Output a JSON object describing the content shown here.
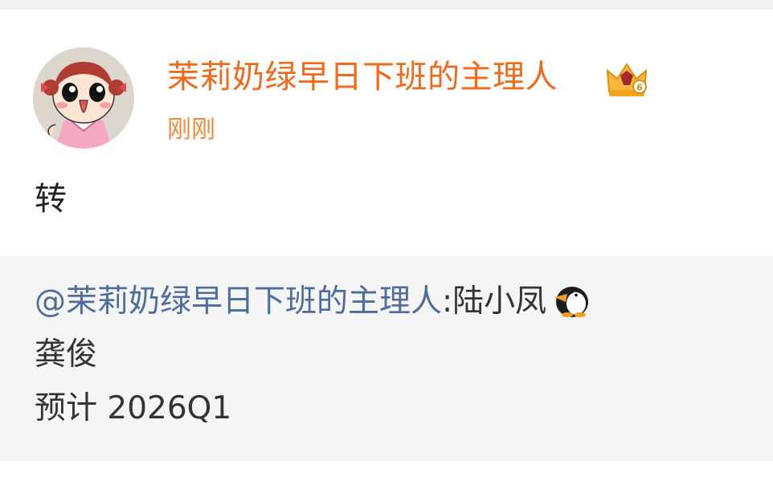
{
  "post": {
    "author_name": "茉莉奶绿早日下班的主理人",
    "time": "刚刚",
    "text": "转",
    "badge_icon": "crown-level-badge-icon"
  },
  "repost": {
    "mention": "@茉莉奶绿早日下班的主理人",
    "body_line1": ":陆小凤",
    "emoji_icon": "penguin-icon",
    "body_line2": "龚俊",
    "body_line3": "预计 2026Q1"
  },
  "colors": {
    "author_name": "#f06a1a",
    "time": "#f28a3a",
    "mention": "#4f6d9a",
    "text": "#222222",
    "repost_background": "#f5f5f5"
  }
}
